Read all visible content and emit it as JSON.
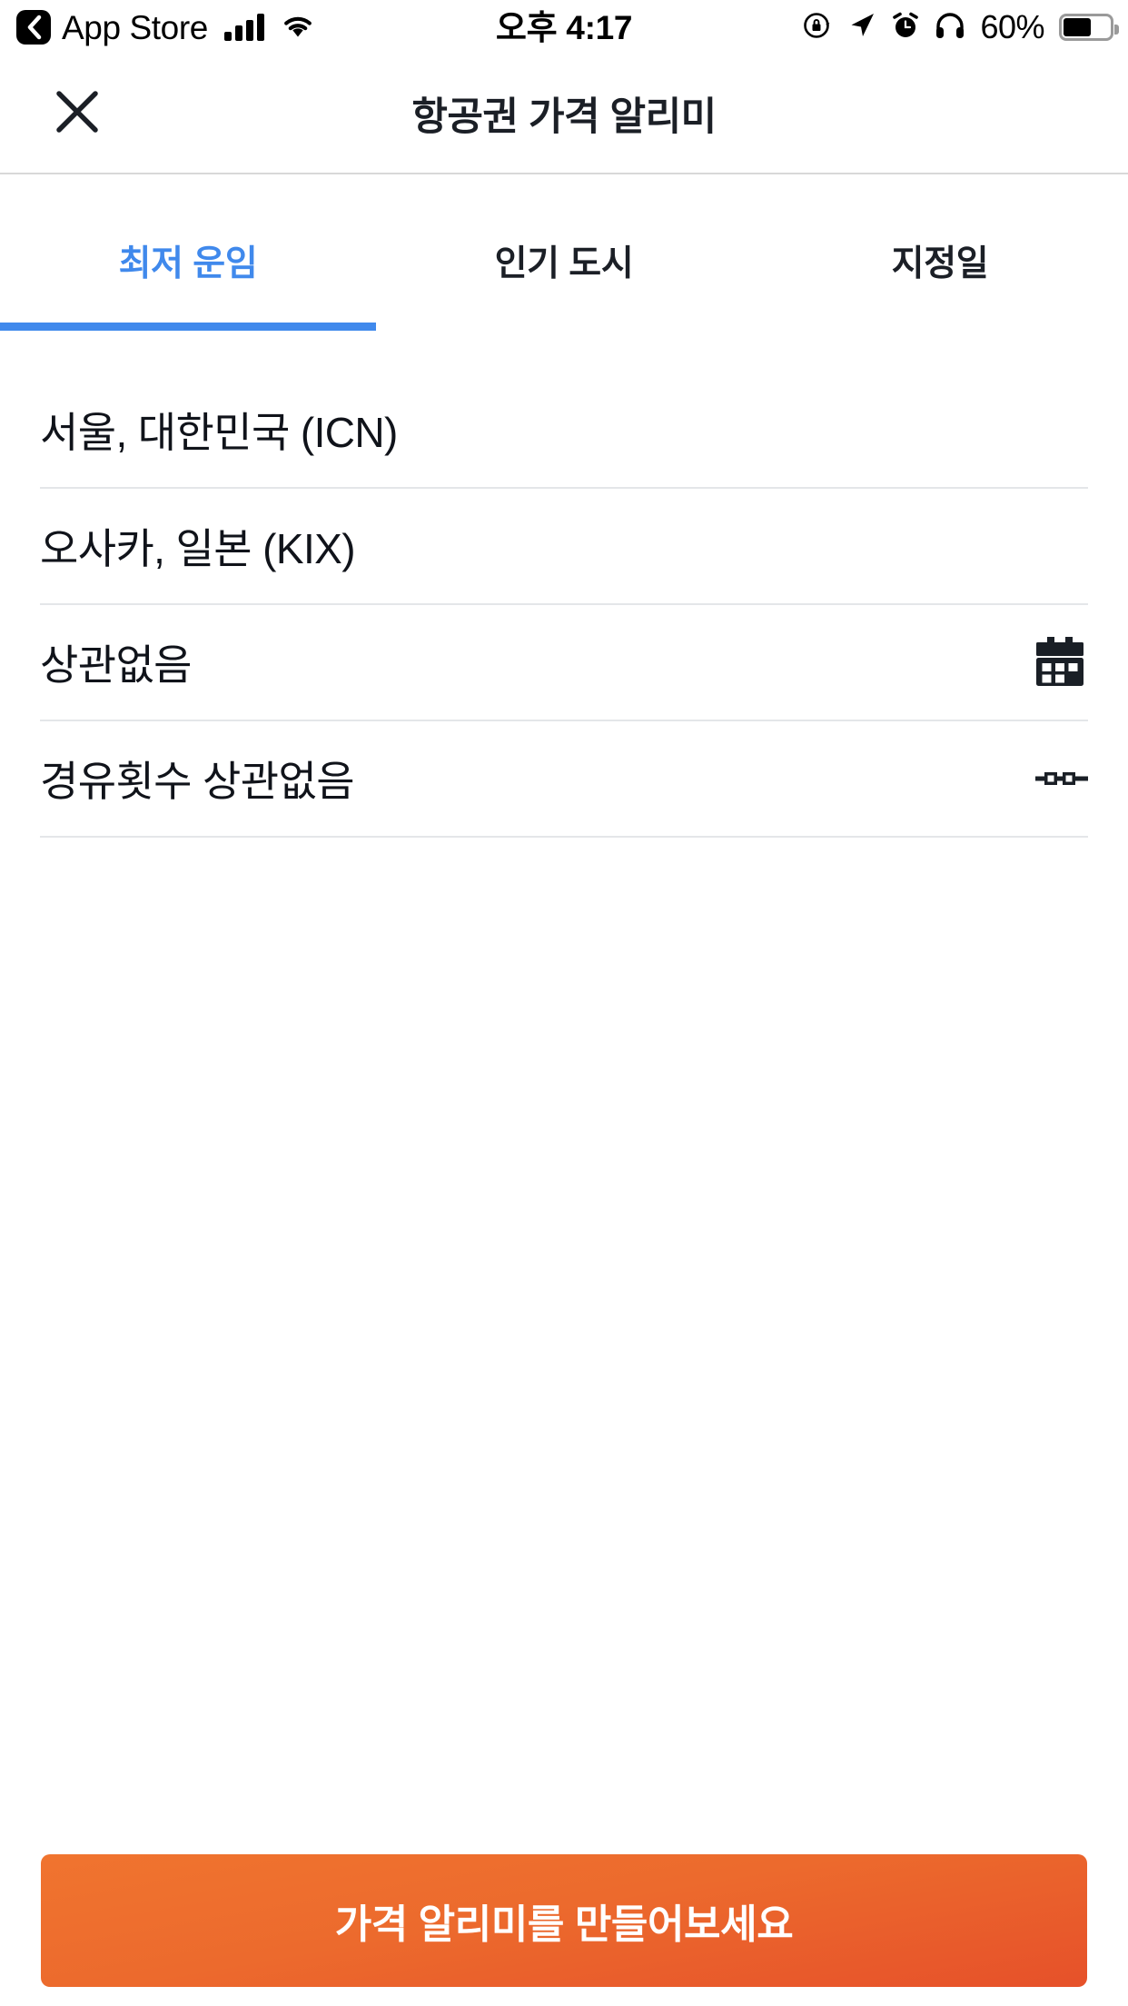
{
  "status_bar": {
    "back_app_label": "App Store",
    "back_icon": "chevron-left-icon",
    "signal_icon": "cellular-signal-icon",
    "wifi_icon": "wifi-icon",
    "time": "오후 4:17",
    "rotation_lock_icon": "rotation-lock-icon",
    "location_icon": "location-arrow-icon",
    "alarm_icon": "alarm-clock-icon",
    "headphones_icon": "headphones-icon",
    "battery_percent": "60%",
    "battery_level": 60,
    "battery_icon": "battery-icon"
  },
  "header": {
    "close_icon": "close-icon",
    "title": "항공권 가격 알리미"
  },
  "tabs": {
    "active_index": 0,
    "items": [
      {
        "label": "최저 운임"
      },
      {
        "label": "인기 도시"
      },
      {
        "label": "지정일"
      }
    ]
  },
  "form": {
    "rows": [
      {
        "value": "서울, 대한민국 (ICN)",
        "name": "origin-row",
        "icon": null
      },
      {
        "value": "오사카, 일본 (KIX)",
        "name": "destination-row",
        "icon": null
      },
      {
        "value": "상관없음",
        "name": "date-row",
        "icon": "calendar-icon"
      },
      {
        "value": "경유횟수 상관없음",
        "name": "stops-row",
        "icon": "stops-icon"
      }
    ]
  },
  "cta": {
    "label": "가격 알리미를 만들어보세요"
  },
  "colors": {
    "accent_blue": "#4089ec",
    "cta_orange_top": "#f0742f",
    "cta_orange_bottom": "#e6512a",
    "text_dark": "#10131a",
    "divider": "#e4e6e9"
  }
}
